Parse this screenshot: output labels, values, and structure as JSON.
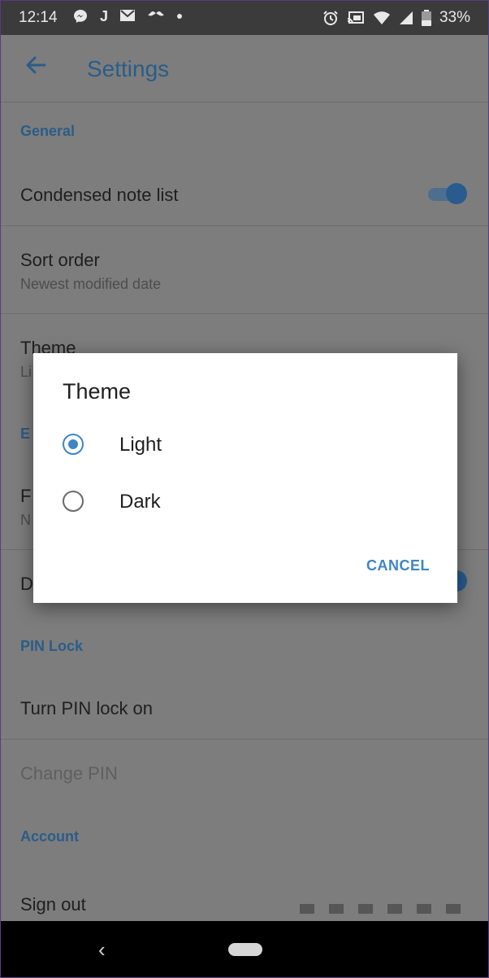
{
  "status_bar": {
    "time": "12:14",
    "left_icons": [
      "messenger-icon",
      "j-app-icon",
      "gmail-icon",
      "mustache-icon",
      "dot-icon"
    ],
    "j_glyph": "J",
    "battery_text": "33%",
    "right_icons": [
      "alarm-icon",
      "cast-icon",
      "wifi-icon",
      "signal-icon",
      "battery-icon"
    ]
  },
  "app_bar": {
    "title": "Settings",
    "back_icon": "back-arrow-icon"
  },
  "settings": {
    "general_header": "General",
    "condensed_label": "Condensed note list",
    "condensed_enabled": true,
    "sort_label": "Sort order",
    "sort_value": "Newest modified date",
    "theme_label": "Theme",
    "theme_value_partial": "Li",
    "editor_header_partial": "E",
    "font_label_partial": "F",
    "font_value_partial": "N",
    "d_label_partial": "D",
    "d_enabled": true,
    "pin_header": "PIN Lock",
    "pin_turn_on": "Turn PIN lock on",
    "pin_change": "Change PIN",
    "account_header": "Account",
    "sign_out": "Sign out"
  },
  "dialog": {
    "title": "Theme",
    "options": [
      {
        "label": "Light",
        "selected": true
      },
      {
        "label": "Dark",
        "selected": false
      }
    ],
    "cancel": "CANCEL"
  },
  "nav_bar": {
    "back_glyph": "‹"
  },
  "colors": {
    "accent": "#3d86c6",
    "dim_accent": "#2a5d88",
    "scrim_bg": "#7d7d7d",
    "status_bar": "#3b3b3b"
  }
}
